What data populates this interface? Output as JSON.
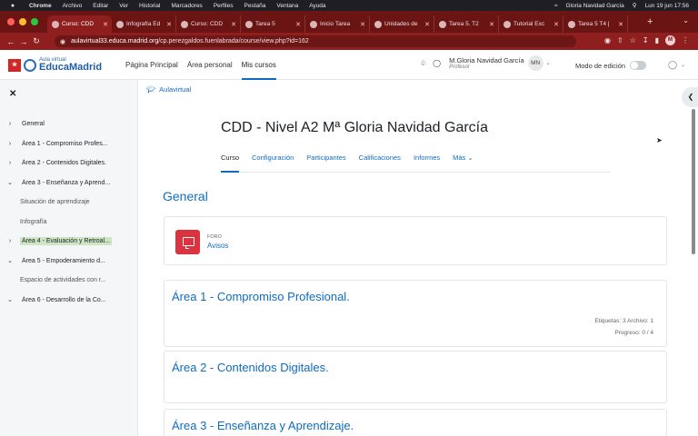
{
  "menubar": {
    "app": "Chrome",
    "items": [
      "Archivo",
      "Editar",
      "Ver",
      "Historial",
      "Marcadores",
      "Perfiles",
      "Pestaña",
      "Ventana",
      "Ayuda"
    ],
    "user": "Gloria Navidad García",
    "datetime": "Lun 19 jun  17:56"
  },
  "browser": {
    "tabs": [
      {
        "title": "Curso: CDD",
        "active": true
      },
      {
        "title": "Infografía Ed",
        "active": false
      },
      {
        "title": "Curso: CDD",
        "active": false
      },
      {
        "title": "Tarea 5",
        "active": false
      },
      {
        "title": "Inicio Tarea ",
        "active": false
      },
      {
        "title": "Unidades de",
        "active": false
      },
      {
        "title": "Tarea 5. T2",
        "active": false
      },
      {
        "title": "Tutorial Exc",
        "active": false
      },
      {
        "title": "Tarea 5 T4 |",
        "active": false
      }
    ],
    "url_host": "aulavirtual33.educa.madrid.org",
    "url_path": "/cp.perezgaldos.fuenlabrada/course/view.php?id=162",
    "profile_initial": "M"
  },
  "site": {
    "logo_small": "Aula virtual",
    "logo_big": "EducaMadrid",
    "nav": [
      {
        "label": "Página Principal",
        "active": false
      },
      {
        "label": "Área personal",
        "active": false
      },
      {
        "label": "Mis cursos",
        "active": true
      }
    ],
    "user_name": "M.Gloria Navidad García",
    "user_role": "Profesor",
    "user_initials": "MN",
    "edit_mode_label": "Modo de edición"
  },
  "course_index": [
    {
      "label": "General",
      "chevron": "›",
      "sub": false,
      "highlight": false
    },
    {
      "label": "Área 1 - Compromiso Profes...",
      "chevron": "›",
      "sub": false,
      "highlight": false
    },
    {
      "label": "Área 2 - Contenidos Digitales.",
      "chevron": "›",
      "sub": false,
      "highlight": false
    },
    {
      "label": "Área 3 - Enseñanza y Aprend...",
      "chevron": "⌄",
      "sub": false,
      "highlight": false
    },
    {
      "label": "Situación de aprendizaje",
      "chevron": "",
      "sub": true,
      "highlight": false
    },
    {
      "label": "Infografía",
      "chevron": "",
      "sub": true,
      "highlight": false
    },
    {
      "label": "Área 4 - Evaluación y Retroal...",
      "chevron": "›",
      "sub": false,
      "highlight": true
    },
    {
      "label": "Área 5 - Empoderamiento d...",
      "chevron": "⌄",
      "sub": false,
      "highlight": false
    },
    {
      "label": "Espacio de actividades con r...",
      "chevron": "",
      "sub": true,
      "highlight": false
    },
    {
      "label": "Área 6 - Desarrollo de la Co...",
      "chevron": "⌄",
      "sub": false,
      "highlight": false
    }
  ],
  "main": {
    "breadcrumb": "Aulavirtual",
    "course_title": "CDD - Nivel A2 Mª Gloria Navidad García",
    "tabs": [
      {
        "label": "Curso",
        "active": true
      },
      {
        "label": "Configuración",
        "active": false
      },
      {
        "label": "Participantes",
        "active": false
      },
      {
        "label": "Calificaciones",
        "active": false
      },
      {
        "label": "Informes",
        "active": false
      },
      {
        "label": "Más ⌄",
        "active": false
      }
    ],
    "general_heading": "General",
    "forum": {
      "type": "FORO",
      "name": "Avisos"
    },
    "sections": [
      {
        "title": "Área 1 - Compromiso Profesional.",
        "meta": "Etiquetas: 3   Archivo: 1",
        "progress": "Progreso: 0 / 4"
      },
      {
        "title": "Área 2 - Contenidos Digitales."
      },
      {
        "title": "Área 3 - Enseñanza y Aprendizaje."
      }
    ]
  },
  "colors": {
    "tabstrip": "#6a1414",
    "toolbar": "#8f1f1f",
    "link": "#0f6cbf",
    "highlight": "#cce5c2",
    "forum_icon": "#d9343f"
  }
}
